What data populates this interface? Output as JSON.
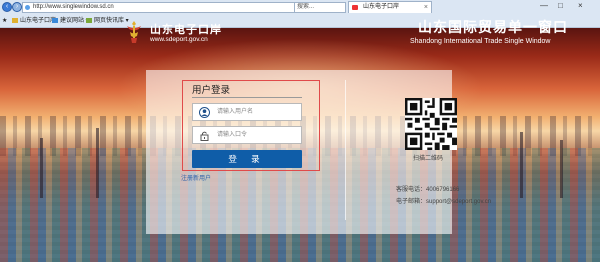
{
  "browser": {
    "address_text": "http://www.singlewindow.sd.cn",
    "search_text": "搜索...",
    "tab_label": "山东电子口岸",
    "tab_close": "×",
    "window_controls": [
      "—",
      "□",
      "×"
    ],
    "favorites": [
      {
        "label": "山东电子口岸",
        "color": "#e0b030"
      },
      {
        "label": "建议网站 ▾",
        "color": "#3a88d8"
      },
      {
        "label": "网页快讯库 ▾",
        "color": "#7aa83a"
      }
    ]
  },
  "header": {
    "logo_title": "山东电子口岸",
    "logo_url": "www.sdeport.gov.cn",
    "site_title": "山东国际贸易单一窗口",
    "site_subtitle": "Shandong International Trade Single Window"
  },
  "login": {
    "title": "用户登录",
    "username_placeholder": "请输入用户名",
    "password_placeholder": "请输入口令",
    "login_button": "登 录",
    "register_link": "注册新用户"
  },
  "contact": {
    "qr_caption": "扫描二维码",
    "phone_label": "客服电话：",
    "phone": "4006796166",
    "email_label": "电子邮箱：",
    "email": "support@sdeport.gov.cn"
  },
  "colors": {
    "login_button": "#0f5da8",
    "highlight_border": "#e04a4a",
    "link": "#2a5ea8"
  }
}
